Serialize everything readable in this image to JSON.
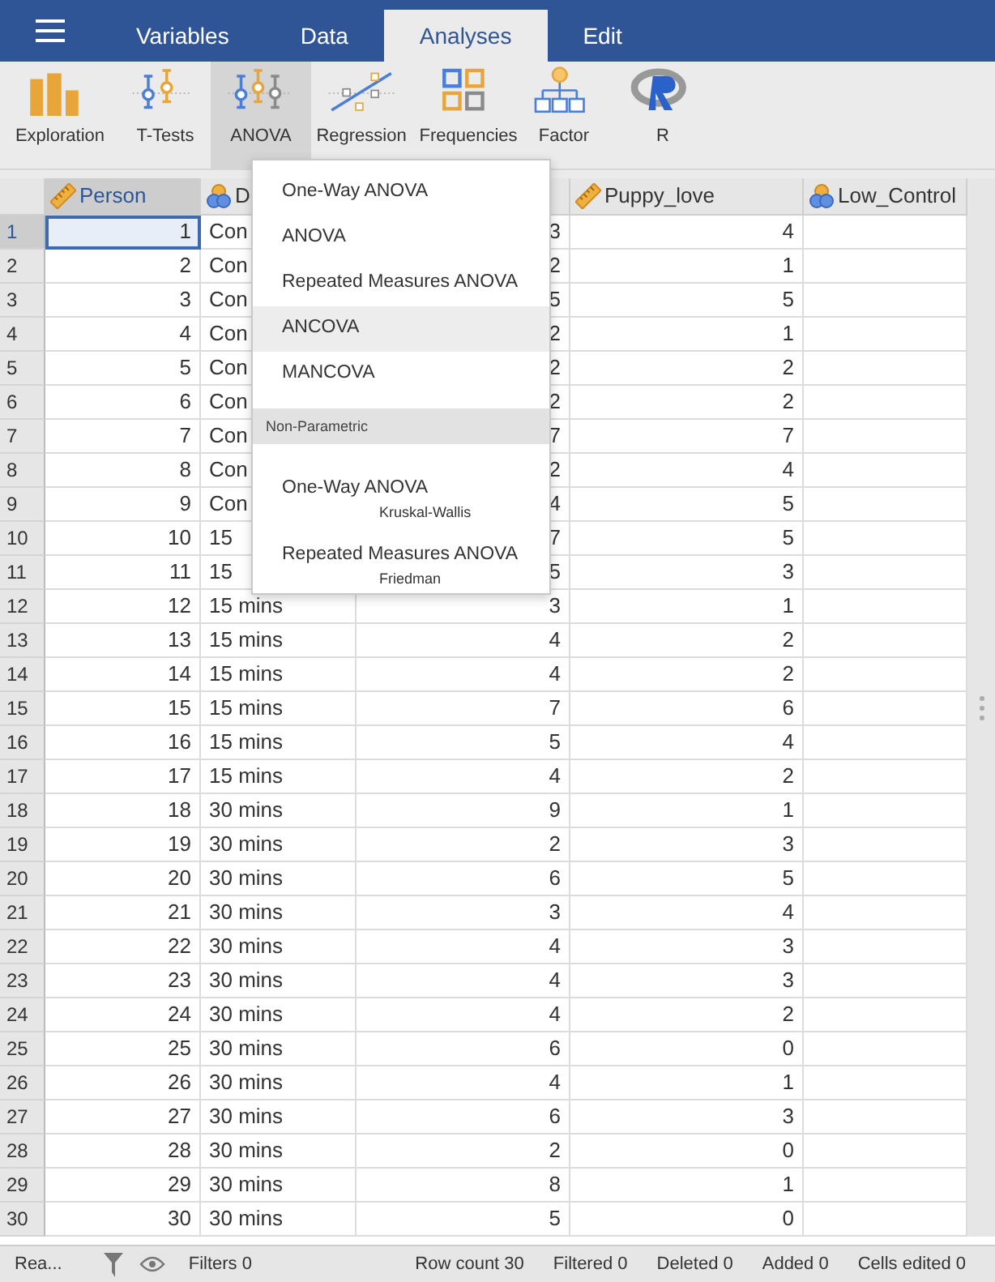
{
  "menu_tabs": [
    {
      "label": "Variables",
      "selected": false
    },
    {
      "label": "Data",
      "selected": false
    },
    {
      "label": "Analyses",
      "selected": true
    },
    {
      "label": "Edit",
      "selected": false
    }
  ],
  "toolbar": [
    {
      "label": "Exploration",
      "kind": "exploration",
      "selected": false
    },
    {
      "label": "T-Tests",
      "kind": "ttests",
      "selected": false
    },
    {
      "label": "ANOVA",
      "kind": "anova",
      "selected": true
    },
    {
      "label": "Regression",
      "kind": "regression",
      "selected": false
    },
    {
      "label": "Frequencies",
      "kind": "frequencies",
      "selected": false
    },
    {
      "label": "Factor",
      "kind": "factor",
      "selected": false
    },
    {
      "label": "R",
      "kind": "r",
      "selected": false
    }
  ],
  "table": {
    "columns": [
      {
        "name": "Person",
        "kind": "continuous",
        "selected": true
      },
      {
        "name": "D",
        "kind": "nominal",
        "selected": false
      },
      {
        "kind": "hidden",
        "selected": false
      },
      {
        "name": "Puppy_love",
        "kind": "continuous",
        "selected": false
      },
      {
        "name": "Low_Control",
        "kind": "nominal",
        "selected": false
      }
    ],
    "rows": [
      {
        "n": "1",
        "cells": [
          "1",
          "Con",
          "3",
          "4",
          ""
        ],
        "selected": true
      },
      {
        "n": "2",
        "cells": [
          "2",
          "Con",
          "2",
          "1",
          ""
        ],
        "selected": false
      },
      {
        "n": "3",
        "cells": [
          "3",
          "Con",
          "5",
          "5",
          ""
        ],
        "selected": false
      },
      {
        "n": "4",
        "cells": [
          "4",
          "Con",
          "2",
          "1",
          ""
        ],
        "selected": false
      },
      {
        "n": "5",
        "cells": [
          "5",
          "Con",
          "2",
          "2",
          ""
        ],
        "selected": false
      },
      {
        "n": "6",
        "cells": [
          "6",
          "Con",
          "2",
          "2",
          ""
        ],
        "selected": false
      },
      {
        "n": "7",
        "cells": [
          "7",
          "Con",
          "7",
          "7",
          ""
        ],
        "selected": false
      },
      {
        "n": "8",
        "cells": [
          "8",
          "Con",
          "2",
          "4",
          ""
        ],
        "selected": false
      },
      {
        "n": "9",
        "cells": [
          "9",
          "Con",
          "4",
          "5",
          ""
        ],
        "selected": false
      },
      {
        "n": "10",
        "cells": [
          "10",
          "15",
          "7",
          "5",
          ""
        ],
        "selected": false
      },
      {
        "n": "11",
        "cells": [
          "11",
          "15",
          "5",
          "3",
          ""
        ],
        "selected": false
      },
      {
        "n": "12",
        "cells": [
          "12",
          "15 mins",
          "3",
          "1",
          ""
        ],
        "selected": false
      },
      {
        "n": "13",
        "cells": [
          "13",
          "15 mins",
          "4",
          "2",
          ""
        ],
        "selected": false
      },
      {
        "n": "14",
        "cells": [
          "14",
          "15 mins",
          "4",
          "2",
          ""
        ],
        "selected": false
      },
      {
        "n": "15",
        "cells": [
          "15",
          "15 mins",
          "7",
          "6",
          ""
        ],
        "selected": false
      },
      {
        "n": "16",
        "cells": [
          "16",
          "15 mins",
          "5",
          "4",
          ""
        ],
        "selected": false
      },
      {
        "n": "17",
        "cells": [
          "17",
          "15 mins",
          "4",
          "2",
          ""
        ],
        "selected": false
      },
      {
        "n": "18",
        "cells": [
          "18",
          "30 mins",
          "9",
          "1",
          ""
        ],
        "selected": false
      },
      {
        "n": "19",
        "cells": [
          "19",
          "30 mins",
          "2",
          "3",
          ""
        ],
        "selected": false
      },
      {
        "n": "20",
        "cells": [
          "20",
          "30 mins",
          "6",
          "5",
          ""
        ],
        "selected": false
      },
      {
        "n": "21",
        "cells": [
          "21",
          "30 mins",
          "3",
          "4",
          ""
        ],
        "selected": false
      },
      {
        "n": "22",
        "cells": [
          "22",
          "30 mins",
          "4",
          "3",
          ""
        ],
        "selected": false
      },
      {
        "n": "23",
        "cells": [
          "23",
          "30 mins",
          "4",
          "3",
          ""
        ],
        "selected": false
      },
      {
        "n": "24",
        "cells": [
          "24",
          "30 mins",
          "4",
          "2",
          ""
        ],
        "selected": false
      },
      {
        "n": "25",
        "cells": [
          "25",
          "30 mins",
          "6",
          "0",
          ""
        ],
        "selected": false
      },
      {
        "n": "26",
        "cells": [
          "26",
          "30 mins",
          "4",
          "1",
          ""
        ],
        "selected": false
      },
      {
        "n": "27",
        "cells": [
          "27",
          "30 mins",
          "6",
          "3",
          ""
        ],
        "selected": false
      },
      {
        "n": "28",
        "cells": [
          "28",
          "30 mins",
          "2",
          "0",
          ""
        ],
        "selected": false
      },
      {
        "n": "29",
        "cells": [
          "29",
          "30 mins",
          "8",
          "1",
          ""
        ],
        "selected": false
      },
      {
        "n": "30",
        "cells": [
          "30",
          "30 mins",
          "5",
          "0",
          ""
        ],
        "selected": false
      }
    ]
  },
  "dropdown": [
    {
      "kind": "item",
      "label": "One-Way ANOVA",
      "selected": false
    },
    {
      "kind": "item",
      "label": "ANOVA",
      "selected": false
    },
    {
      "kind": "item",
      "label": "Repeated Measures ANOVA",
      "selected": false
    },
    {
      "kind": "item",
      "label": "ANCOVA",
      "selected": true
    },
    {
      "kind": "item",
      "label": "MANCOVA",
      "selected": false
    },
    {
      "kind": "header",
      "label": "Non-Parametric"
    },
    {
      "kind": "item",
      "label": "One-Way ANOVA",
      "sub": "Kruskal-Wallis",
      "selected": false
    },
    {
      "kind": "item",
      "label": "Repeated Measures ANOVA",
      "sub": "Friedman",
      "selected": false
    }
  ],
  "status_bar": {
    "ready": "Rea...",
    "filters": "Filters 0",
    "stats": [
      "Row count 30",
      "Filtered 0",
      "Deleted 0",
      "Added 0",
      "Cells edited 0"
    ]
  }
}
